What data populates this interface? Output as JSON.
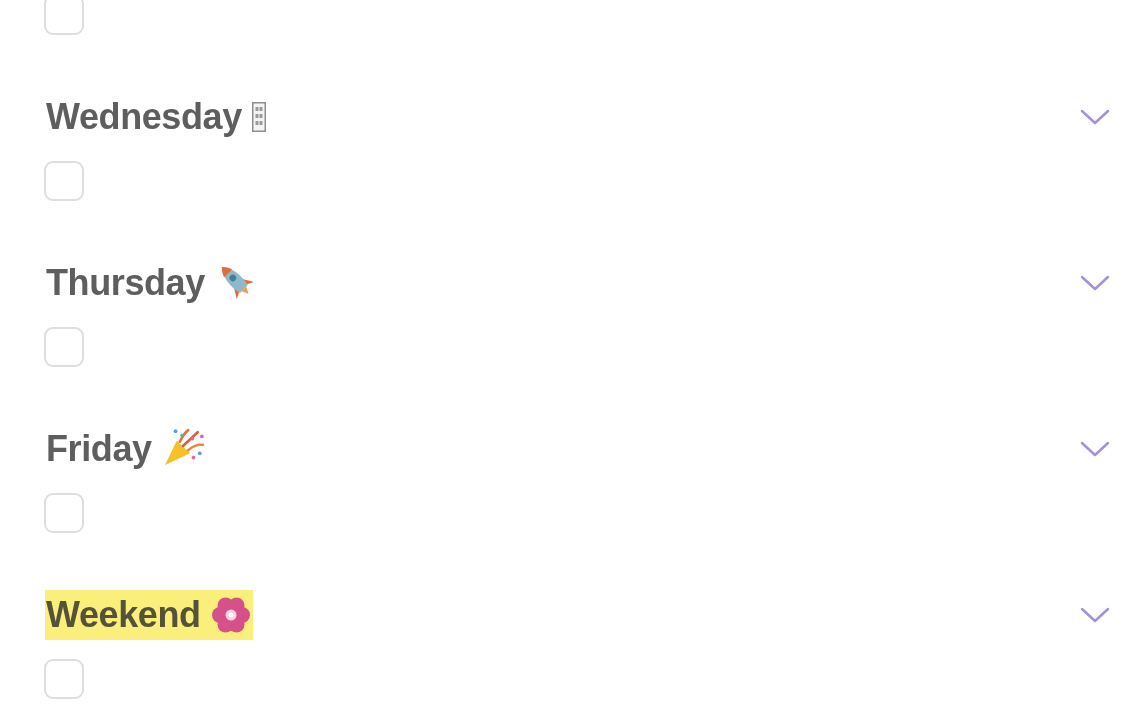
{
  "previous_task": {
    "checked": false
  },
  "sections": [
    {
      "title": "Wednesday",
      "kind": "tofu",
      "highlighted": false,
      "task": {
        "checked": false
      }
    },
    {
      "title": "Thursday",
      "kind": "rocket",
      "highlighted": false,
      "task": {
        "checked": false
      }
    },
    {
      "title": "Friday",
      "kind": "confetti",
      "highlighted": false,
      "task": {
        "checked": false
      }
    },
    {
      "title": "Weekend",
      "kind": "flower",
      "highlighted": true,
      "task": {
        "checked": false
      }
    }
  ]
}
